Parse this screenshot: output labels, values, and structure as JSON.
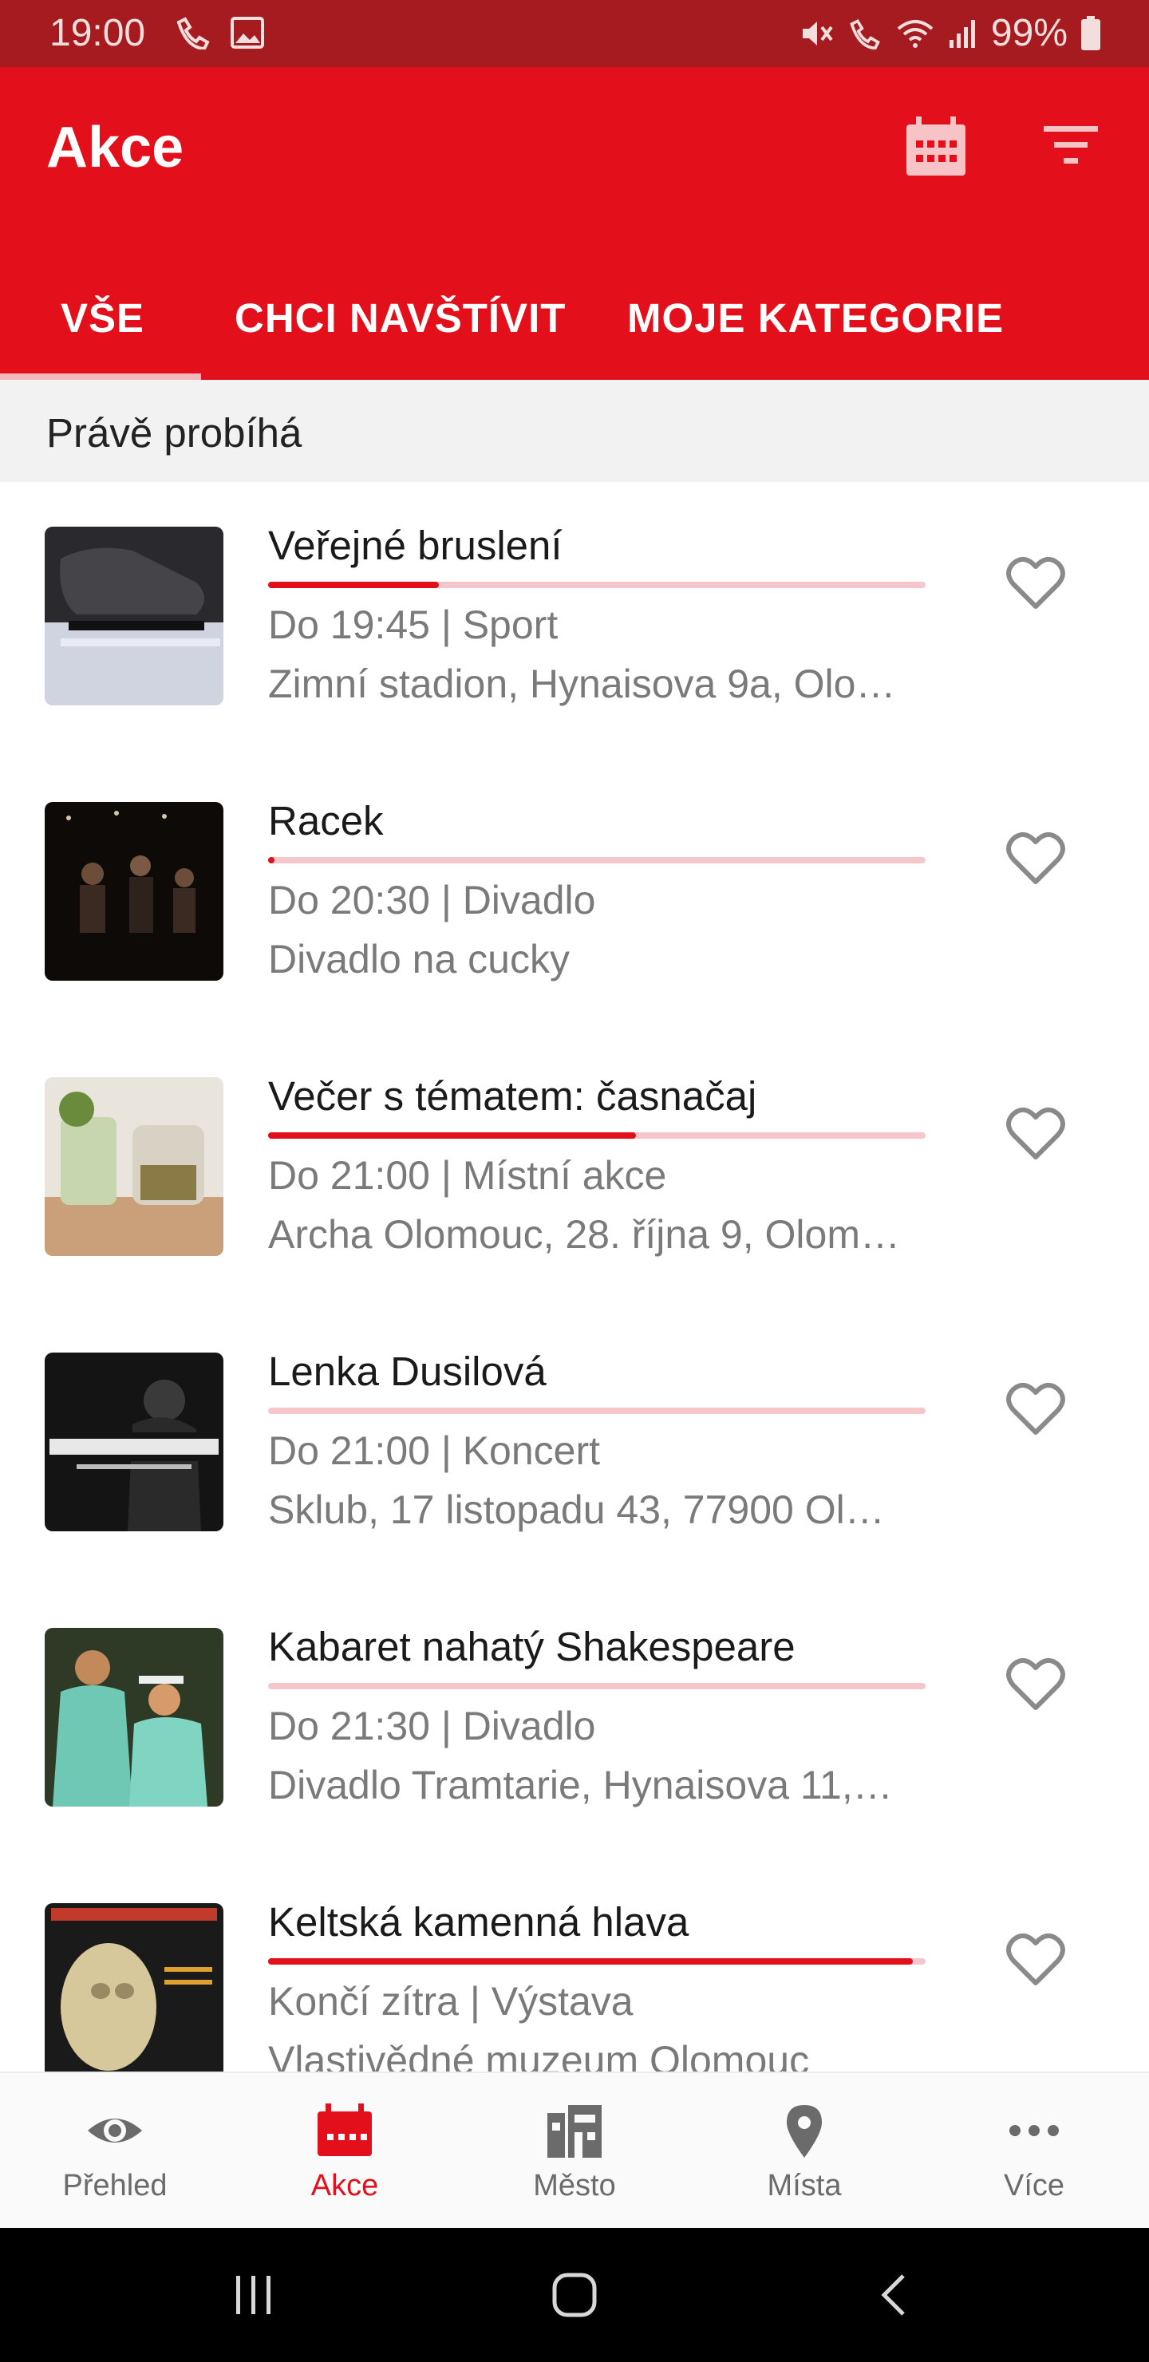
{
  "status_bar": {
    "time": "19:00",
    "battery": "99%"
  },
  "app_bar": {
    "title": "Akce",
    "calendar_icon": "calendar-icon",
    "filter_icon": "filter-icon"
  },
  "tabs": [
    {
      "label": "VŠE",
      "selected": true
    },
    {
      "label": "CHCI NAVŠTÍVIT",
      "selected": false
    },
    {
      "label": "MOJE KATEGORIE",
      "selected": false
    }
  ],
  "section": {
    "title": "Právě probíhá"
  },
  "events": [
    {
      "title": "Veřejné bruslení",
      "meta": "Do 19:45 | Sport",
      "place": "Zimní stadion, Hynaisova 9a, Olo…",
      "progress": 0.26
    },
    {
      "title": "Racek",
      "meta": "Do 20:30 | Divadlo",
      "place": "Divadlo na cucky",
      "progress": 0.01
    },
    {
      "title": "Večer s tématem: časnačaj",
      "meta": "Do 21:00 | Místní akce",
      "place": "Archa Olomouc, 28. října 9, Olom…",
      "progress": 0.56
    },
    {
      "title": "Lenka Dusilová",
      "meta": "Do 21:00 | Koncert",
      "place": "Sklub, 17 listopadu 43, 77900 Ol…",
      "progress": 0.0
    },
    {
      "title": "Kabaret nahatý Shakespeare",
      "meta": "Do 21:30 | Divadlo",
      "place": "Divadlo Tramtarie, Hynaisova 11,…",
      "progress": 0.0
    },
    {
      "title": "Keltská kamenná hlava",
      "meta": "Končí zítra | Výstava",
      "place": "Vlastivědné muzeum Olomouc",
      "progress": 0.98
    }
  ],
  "bottom_nav": [
    {
      "label": "Přehled",
      "icon": "eye-icon",
      "active": false
    },
    {
      "label": "Akce",
      "icon": "calendar-icon",
      "active": true
    },
    {
      "label": "Město",
      "icon": "city-icon",
      "active": false
    },
    {
      "label": "Místa",
      "icon": "location-pin-icon",
      "active": false
    },
    {
      "label": "Více",
      "icon": "more-icon",
      "active": false
    }
  ],
  "colors": {
    "primary": "#e3101b",
    "status_bar": "#a51b1f",
    "inactive": "#6b6b6b"
  }
}
